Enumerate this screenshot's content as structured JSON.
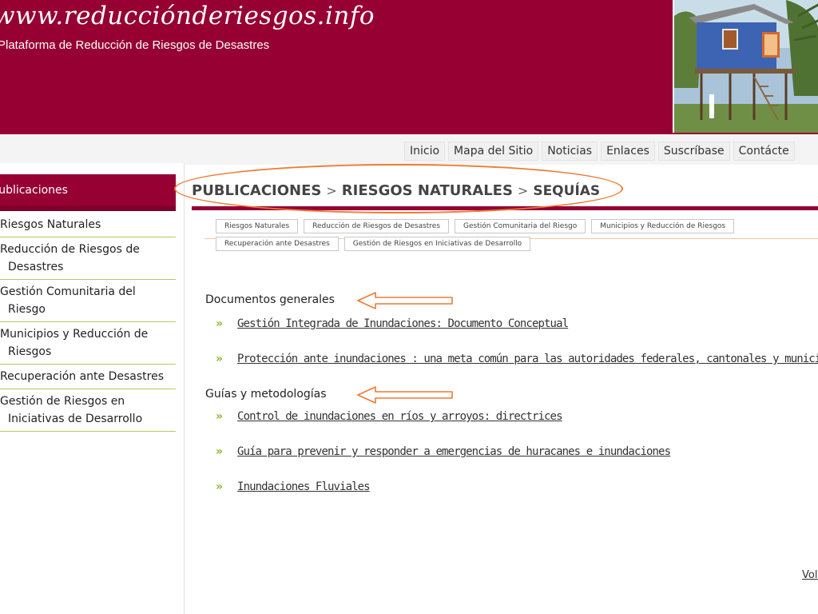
{
  "header": {
    "site_title": "www.reducciónderiesgos.info",
    "subtitle": "Plataforma de Reducción de Riesgos de Desastres"
  },
  "topnav": [
    {
      "label": "Inicio"
    },
    {
      "label": "Mapa del Sitio"
    },
    {
      "label": "Noticias"
    },
    {
      "label": "Enlaces"
    },
    {
      "label": "Suscríbase"
    },
    {
      "label": "Contácte"
    }
  ],
  "sidebar": {
    "heading": "Publicaciones",
    "items": [
      {
        "label": "Riesgos Naturales"
      },
      {
        "label": "Reducción de Riesgos de Desastres"
      },
      {
        "label": "Gestión Comunitaria del Riesgo"
      },
      {
        "label": "Municipios y Reducción de Riesgos"
      },
      {
        "label": "Recuperación ante Desastres"
      },
      {
        "label": "Gestión de Riesgos en Iniciativas de Desarrollo"
      }
    ]
  },
  "breadcrumb": {
    "part1": "PUBLICACIONES",
    "part2": "RIESGOS NATURALES",
    "part3": "SEQUÍAS",
    "separator": ">"
  },
  "subtabs": {
    "row1": [
      "Riesgos Naturales",
      "Reducción de Riesgos de Desastres",
      "Gestión Comunitaria del Riesgo",
      "Municipios y Reducción de Riesgos"
    ],
    "row2": [
      "Recuperación ante Desastres",
      "Gestión de Riesgos en Iniciativas de Desarrollo"
    ]
  },
  "sections": {
    "general": {
      "title": "Documentos generales",
      "links": [
        "Gestión Integrada de Inundaciones: Documento Conceptual",
        "Protección ante inundaciones : una meta común para las autoridades federales, cantonales y municipales"
      ]
    },
    "guides": {
      "title": "Guías y metodologías",
      "links": [
        "Control de inundaciones en ríos y arroyos: directrices",
        "Guía para prevenir y responder a emergencias de huracanes e inundaciones",
        "Inundaciones Fluviales"
      ]
    }
  },
  "footer": {
    "back_link": "Volver"
  },
  "colors": {
    "brand": "#960033",
    "accent_orange": "#ee7a33",
    "bullet_green": "#8cb82f",
    "divider_green": "#b6c960"
  }
}
